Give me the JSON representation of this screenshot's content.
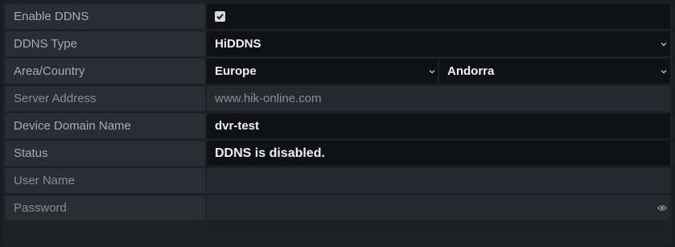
{
  "fields": {
    "enable_ddns": {
      "label": "Enable DDNS",
      "checked": true
    },
    "ddns_type": {
      "label": "DDNS Type",
      "value": "HiDDNS"
    },
    "area_country": {
      "label": "Area/Country",
      "area": "Europe",
      "country": "Andorra"
    },
    "server_address": {
      "label": "Server Address",
      "value": "www.hik-online.com"
    },
    "device_domain_name": {
      "label": "Device Domain Name",
      "value": "dvr-test"
    },
    "status": {
      "label": "Status",
      "value": "DDNS is disabled."
    },
    "user_name": {
      "label": "User Name",
      "value": ""
    },
    "password": {
      "label": "Password",
      "value": ""
    }
  },
  "icons": {
    "check": "check-icon",
    "dropdown": "chevron-down-icon",
    "reveal": "eye-icon"
  }
}
